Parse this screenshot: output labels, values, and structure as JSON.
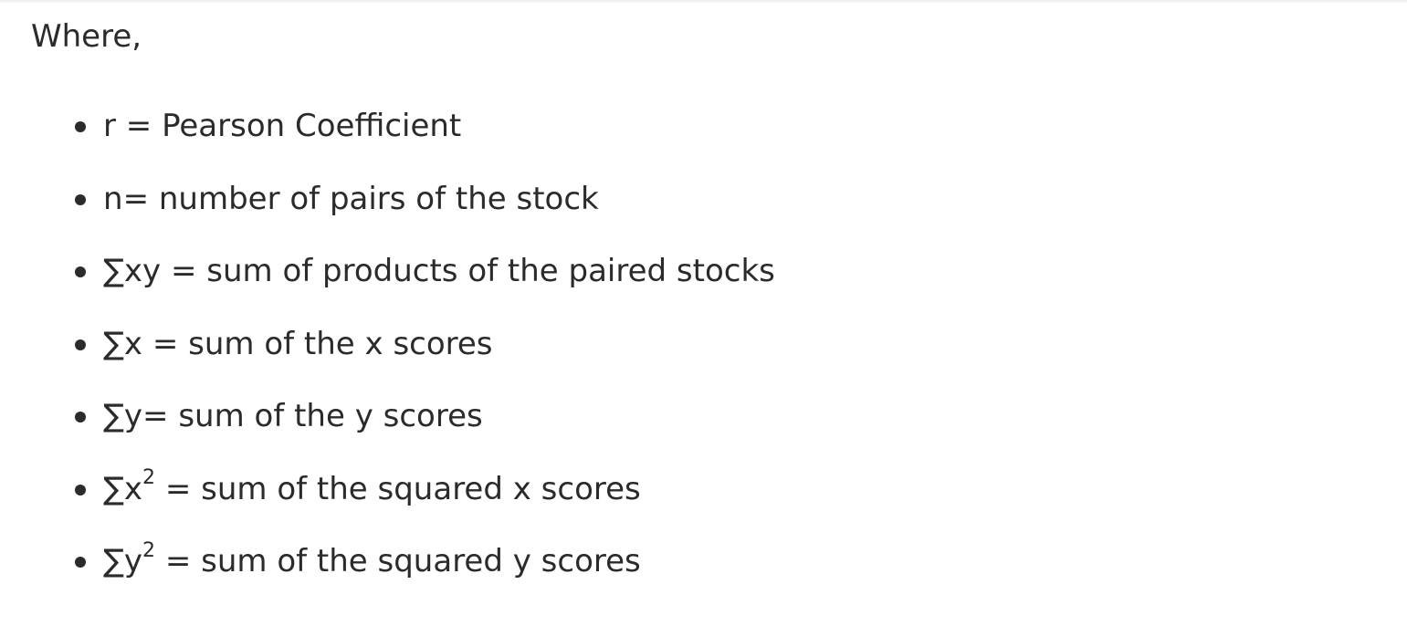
{
  "intro": "Where,",
  "definitions": [
    {
      "symbol": "r",
      "sup": "",
      "sep": " = ",
      "meaning": "Pearson Coefficient"
    },
    {
      "symbol": "n",
      "sup": "",
      "sep": "= ",
      "meaning": "number of pairs of the stock"
    },
    {
      "symbol": "∑xy",
      "sup": "",
      "sep": " = ",
      "meaning": "sum of products of the paired stocks"
    },
    {
      "symbol": "∑x",
      "sup": "",
      "sep": " = ",
      "meaning": "sum of the x scores"
    },
    {
      "symbol": "∑y",
      "sup": "",
      "sep": "= ",
      "meaning": "sum of the y scores"
    },
    {
      "symbol": "∑x",
      "sup": "2",
      "sep": " = ",
      "meaning": "sum of the squared x scores"
    },
    {
      "symbol": "∑y",
      "sup": "2",
      "sep": " = ",
      "meaning": "sum of the squared y scores"
    }
  ]
}
